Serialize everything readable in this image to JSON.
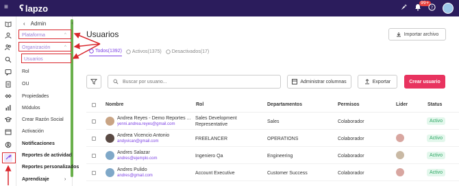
{
  "topbar": {
    "logo_text": "lapzo",
    "notification_count": "99+"
  },
  "icons": {
    "menu": "≡",
    "logo_mark": "ʕ",
    "rocket": "🚀",
    "bell": "🔔",
    "help": "?"
  },
  "subnav": {
    "back_label": "Admin",
    "back_icon": "‹",
    "collapse_icon": "‹",
    "items": [
      {
        "label": "Plataforma"
      },
      {
        "label": "Organización"
      },
      {
        "label": "Usuarios"
      },
      {
        "label": "Rol"
      },
      {
        "label": "OU"
      },
      {
        "label": "Propiedades"
      },
      {
        "label": "Módulos"
      },
      {
        "label": "Crear Razón Social"
      },
      {
        "label": "Activación"
      },
      {
        "label": "Notificaciones"
      },
      {
        "label": "Reportes de actividad"
      },
      {
        "label": "Reportes personalizados"
      },
      {
        "label": "Aprendizaje"
      }
    ]
  },
  "main": {
    "title": "Usuarios",
    "import_label": "Importar archivo",
    "tabs": [
      {
        "label": "Todos(1392)"
      },
      {
        "label": "Activos(1375)"
      },
      {
        "label": "Desactivados(17)"
      }
    ],
    "search_placeholder": "Buscar por usuario...",
    "admin_columns_label": "Administrar columnas",
    "export_label": "Exportar",
    "create_label": "Crear usuario"
  },
  "table": {
    "headers": {
      "name": "Nombre",
      "role": "Rol",
      "department": "Departamentos",
      "permissions": "Permisos",
      "leader": "Lider",
      "status": "Status"
    },
    "rows": [
      {
        "name": "Andrea Reyes - Demo Reportes ...",
        "email": "yenni.andrea.reyes@gmail.com",
        "role_line1": "Sales Development",
        "role_line2": "Representative",
        "department": "Sales",
        "permissions": "Colaborador",
        "status": "Activo"
      },
      {
        "name": "Andrea Vicencio Antonio",
        "email": "andyvican@gmail.com",
        "role_line1": "FREELANCER",
        "role_line2": "",
        "department": "OPERATIONS",
        "permissions": "Colaborador",
        "status": "Activo"
      },
      {
        "name": "Andres Salazar",
        "email": "andres@ejemplo.com",
        "role_line1": "Ingeniero Qa",
        "role_line2": "",
        "department": "Engineering",
        "permissions": "Colaborador",
        "status": "Activo"
      },
      {
        "name": "Andres Pulido",
        "email": "andres@gmail.com",
        "role_line1": "Account Executive",
        "role_line2": "",
        "department": "Customer Success",
        "permissions": "Colaborador",
        "status": "Activo"
      }
    ]
  },
  "colors": {
    "topbar": "#2b1c5c",
    "accent_purple": "#7b3fe4",
    "create_button": "#e8335f",
    "annotation_red": "#d9262c",
    "status_green": "#2fa865"
  }
}
